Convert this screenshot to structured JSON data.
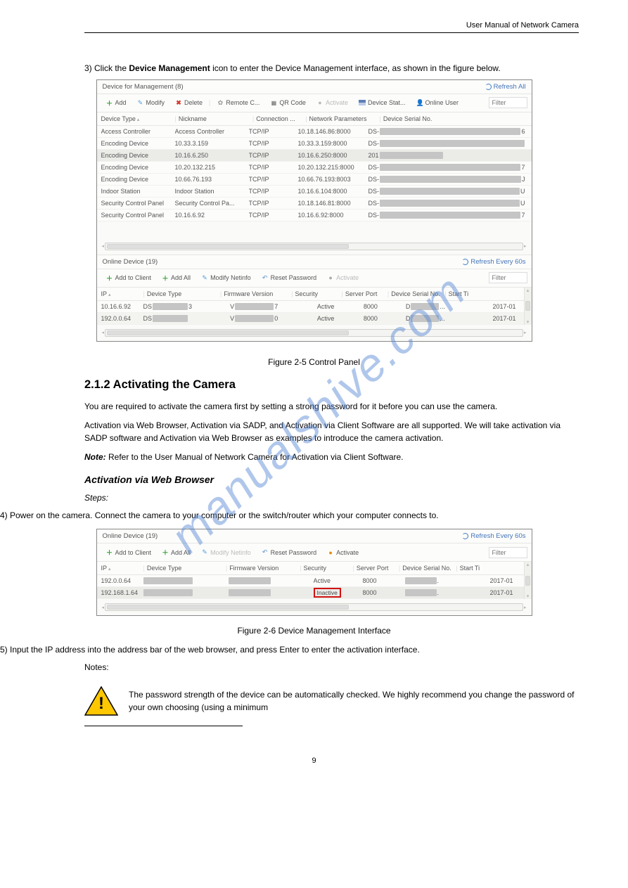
{
  "page": {
    "header_right": "User Manual of Network Camera",
    "number": "9"
  },
  "panel1": {
    "title": "Device for Management (8)",
    "refresh": "Refresh All",
    "buttons": {
      "add": "Add",
      "modify": "Modify",
      "delete": "Delete",
      "remote": "Remote C...",
      "qr": "QR Code",
      "activate": "Activate",
      "device_stat": "Device Stat...",
      "online_user": "Online User"
    },
    "filter_placeholder": "Filter",
    "headers": [
      "Device Type",
      "Nickname",
      "Connection ...",
      "Network Parameters",
      "Device Serial No."
    ],
    "rows": [
      {
        "devtype": "Access Controller",
        "nick": "Access Controller",
        "conn": "TCP/IP",
        "net": "10.18.146.86:8000",
        "serial_pre": "DS-",
        "serial_suf": "6"
      },
      {
        "devtype": "Encoding Device",
        "nick": "10.33.3.159",
        "conn": "TCP/IP",
        "net": "10.33.3.159:8000",
        "serial_pre": "DS-",
        "serial_suf": ""
      },
      {
        "devtype": "Encoding Device",
        "nick": "10.16.6.250",
        "conn": "TCP/IP",
        "net": "10.16.6.250:8000",
        "serial_pre": "201",
        "serial_suf": "",
        "short": true
      },
      {
        "devtype": "Encoding Device",
        "nick": "10.20.132.215",
        "conn": "TCP/IP",
        "net": "10.20.132.215:8000",
        "serial_pre": "DS-",
        "serial_suf": "7"
      },
      {
        "devtype": "Encoding Device",
        "nick": "10.66.76.193",
        "conn": "TCP/IP",
        "net": "10.66.76.193:8003",
        "serial_pre": "DS-",
        "serial_suf": "J"
      },
      {
        "devtype": "Indoor Station",
        "nick": "Indoor Station",
        "conn": "TCP/IP",
        "net": "10.16.6.104:8000",
        "serial_pre": "DS-",
        "serial_suf": "U"
      },
      {
        "devtype": "Security Control Panel",
        "nick": "Security Control Pa...",
        "conn": "TCP/IP",
        "net": "10.18.146.81:8000",
        "serial_pre": "DS-",
        "serial_suf": "U"
      },
      {
        "devtype": "Security Control Panel",
        "nick": "10.16.6.92",
        "conn": "TCP/IP",
        "net": "10.16.6.92:8000",
        "serial_pre": "DS-",
        "serial_suf": "7"
      }
    ]
  },
  "panel2": {
    "title": "Online Device (19)",
    "refresh": "Refresh Every 60s",
    "buttons": {
      "add_client": "Add to Client",
      "add_all": "Add All",
      "modify_net": "Modify Netinfo",
      "reset_pw": "Reset Password",
      "activate": "Activate"
    },
    "filter_placeholder": "Filter",
    "headers": [
      "IP",
      "Device Type",
      "Firmware Version",
      "Security",
      "Server Port",
      "Device Serial No.",
      "Start Ti"
    ],
    "rows": [
      {
        "ip": "10.16.6.92",
        "dev_pre": "DS",
        "dev_suf": "3",
        "fw_pre": "V",
        "fw_suf": "7",
        "sec": "Active",
        "port": "8000",
        "serial_pre": "D",
        "serial_suf": "...",
        "start": "2017-01"
      },
      {
        "ip": "192.0.0.64",
        "dev_pre": "DS",
        "dev_suf": "",
        "fw_pre": "V",
        "fw_suf": "0",
        "sec": "Active",
        "port": "8000",
        "serial_pre": "D",
        "serial_suf": "...",
        "start": "2017-01"
      }
    ]
  },
  "fig1_caption": "Figure 2-5 Control Panel",
  "text1": {
    "para1": "3) Click the ",
    "para1b": "Device Management ",
    "para1c": "icon to enter the Device Management interface, as shown in the figure below."
  },
  "heading": "2.1.2  Activating the Camera",
  "text2": {
    "p1": "You are required to activate the camera first by setting a strong password for it before you can use the camera.",
    "p2a": "Activation via Web Browser, Activation via SADP, and Activation via Client Software are all supported. We will take activation via SADP software and Activation via Web Browser as examples to introduce the camera activation.",
    "note_lbl": "Note:",
    "note_body": " Refer to the User Manual of Network Camera for Activation via Client Software."
  },
  "sub_heading": "Activation via Web Browser",
  "steps_label": "Steps:",
  "step1": "4) Power on the camera. Connect the camera to your computer or the switch/router which your computer connects to.",
  "panel3": {
    "title": "Online Device (19)",
    "refresh": "Refresh Every 60s",
    "buttons": {
      "add_client": "Add to Client",
      "add_all": "Add All",
      "modify_net": "Modify Netinfo",
      "reset_pw": "Reset Password",
      "activate": "Activate"
    },
    "filter_placeholder": "Filter",
    "headers": [
      "IP",
      "Device Type",
      "Firmware Version",
      "Security",
      "Server Port",
      "Device Serial No.",
      "Start Ti"
    ],
    "rows": [
      {
        "ip": "192.0.0.64",
        "sec": "Active",
        "port": "8000",
        "start": "2017-01",
        "inactive": false
      },
      {
        "ip": "192.168.1.64",
        "sec": "Inactive",
        "port": "8000",
        "start": "2017-01",
        "inactive": true
      }
    ]
  },
  "fig2_caption": "Figure 2-6 Device Management Interface",
  "step5": "5) Input the IP address into the address bar of the web browser, and press Enter to enter the activation interface.",
  "notes_label": "Notes:",
  "warning_text": "The password strength of the device can be automatically checked. We highly recommend you change the password of your own choosing (using a minimum"
}
